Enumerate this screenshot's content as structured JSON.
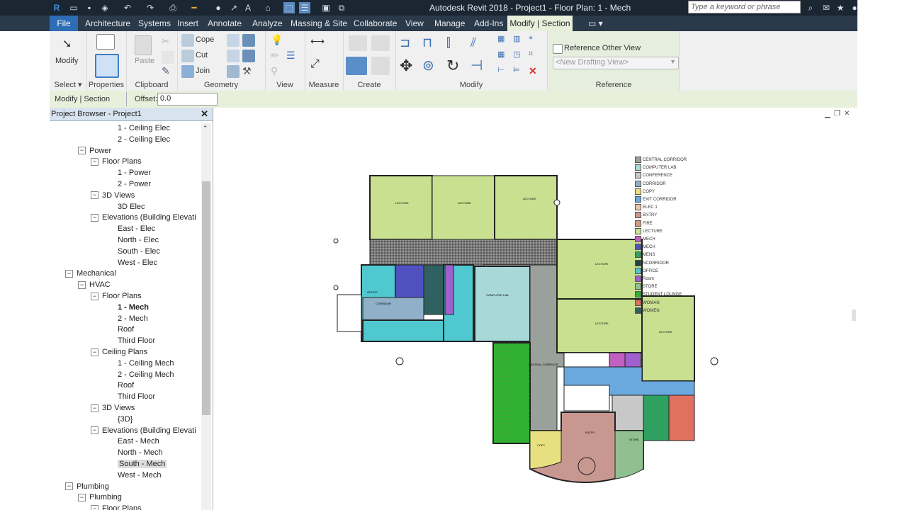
{
  "window": {
    "title": "Autodesk Revit 2018 -    Project1 - Floor Plan: 1 - Mech",
    "search_placeholder": "Type a keyword or phrase"
  },
  "tabs": [
    "File",
    "Architecture",
    "Systems",
    "Insert",
    "Annotate",
    "Analyze",
    "Massing & Site",
    "Collaborate",
    "View",
    "Manage",
    "Add-Ins",
    "Modify | Section"
  ],
  "ribbon": {
    "select_panel": {
      "button": "Modify",
      "label": "Select ▾"
    },
    "properties_panel": {
      "label": "Properties"
    },
    "clipboard_panel": {
      "paste": "Paste",
      "label": "Clipboard"
    },
    "geometry_panel": {
      "cope": "Cope",
      "cut": "Cut",
      "join": "Join",
      "label": "Geometry"
    },
    "view_panel": {
      "label": "View"
    },
    "measure_panel": {
      "label": "Measure"
    },
    "create_panel": {
      "label": "Create"
    },
    "modify_panel": {
      "label": "Modify"
    },
    "reference_panel": {
      "checkbox_label": "Reference Other View",
      "dropdown_value": "<New Drafting View>",
      "label": "Reference"
    }
  },
  "options_bar": {
    "context": "Modify | Section",
    "offset_label": "Offset:",
    "offset_value": "0.0"
  },
  "project_browser": {
    "title": "Project Browser - Project1",
    "nodes": [
      {
        "label": "1 - Ceiling Elec",
        "level": 4,
        "exp": ""
      },
      {
        "label": "2 - Ceiling Elec",
        "level": 4,
        "exp": ""
      },
      {
        "label": "Power",
        "level": 2,
        "exp": "−"
      },
      {
        "label": "Floor Plans",
        "level": 3,
        "exp": "−"
      },
      {
        "label": "1 - Power",
        "level": 4,
        "exp": ""
      },
      {
        "label": "2 - Power",
        "level": 4,
        "exp": ""
      },
      {
        "label": "3D Views",
        "level": 3,
        "exp": "−"
      },
      {
        "label": "3D Elec",
        "level": 4,
        "exp": ""
      },
      {
        "label": "Elevations (Building Elevati",
        "level": 3,
        "exp": "−"
      },
      {
        "label": "East - Elec",
        "level": 4,
        "exp": ""
      },
      {
        "label": "North - Elec",
        "level": 4,
        "exp": ""
      },
      {
        "label": "South - Elec",
        "level": 4,
        "exp": ""
      },
      {
        "label": "West - Elec",
        "level": 4,
        "exp": ""
      },
      {
        "label": "Mechanical",
        "level": 1,
        "exp": "−"
      },
      {
        "label": "HVAC",
        "level": 2,
        "exp": "−"
      },
      {
        "label": "Floor Plans",
        "level": 3,
        "exp": "−"
      },
      {
        "label": "1 - Mech",
        "level": 4,
        "exp": "",
        "bold": true
      },
      {
        "label": "2 - Mech",
        "level": 4,
        "exp": ""
      },
      {
        "label": "Roof",
        "level": 4,
        "exp": ""
      },
      {
        "label": "Third Floor",
        "level": 4,
        "exp": ""
      },
      {
        "label": "Ceiling Plans",
        "level": 3,
        "exp": "−"
      },
      {
        "label": "1 - Ceiling Mech",
        "level": 4,
        "exp": ""
      },
      {
        "label": "2 - Ceiling Mech",
        "level": 4,
        "exp": ""
      },
      {
        "label": "Roof",
        "level": 4,
        "exp": ""
      },
      {
        "label": "Third Floor",
        "level": 4,
        "exp": ""
      },
      {
        "label": "3D Views",
        "level": 3,
        "exp": "−"
      },
      {
        "label": "{3D}",
        "level": 4,
        "exp": ""
      },
      {
        "label": "Elevations (Building Elevati",
        "level": 3,
        "exp": "−"
      },
      {
        "label": "East - Mech",
        "level": 4,
        "exp": ""
      },
      {
        "label": "North - Mech",
        "level": 4,
        "exp": ""
      },
      {
        "label": "South - Mech",
        "level": 4,
        "exp": "",
        "selected": true
      },
      {
        "label": "West - Mech",
        "level": 4,
        "exp": ""
      },
      {
        "label": "Plumbing",
        "level": 1,
        "exp": "−"
      },
      {
        "label": "Plumbing",
        "level": 2,
        "exp": "−"
      },
      {
        "label": "Floor Plans",
        "level": 3,
        "exp": "−"
      }
    ]
  },
  "legend": [
    {
      "label": "CENTRAL CORRIDOR",
      "color": "#9aa09a"
    },
    {
      "label": "COMPUTER LAB",
      "color": "#a8d8d8"
    },
    {
      "label": "CONFERENCE",
      "color": "#c8c8c8"
    },
    {
      "label": "CORRIDOR",
      "color": "#8fb0c8"
    },
    {
      "label": "COPY",
      "color": "#e8e080"
    },
    {
      "label": "EXIT CORRIDOR",
      "color": "#6aa8e0"
    },
    {
      "label": "ELEC 1",
      "color": "#e8c8a8"
    },
    {
      "label": "ENTRY",
      "color": "#c89890"
    },
    {
      "label": "FIRE",
      "color": "#d09a80"
    },
    {
      "label": "LECTURE",
      "color": "#c8e090"
    },
    {
      "label": "MECH",
      "color": "#c060c0"
    },
    {
      "label": "MECH",
      "color": "#5050c0"
    },
    {
      "label": "MENS",
      "color": "#30a060"
    },
    {
      "label": "NCORRIDOR",
      "color": "#204040"
    },
    {
      "label": "OFFICE",
      "color": "#50c8d0"
    },
    {
      "label": "Room",
      "color": "#a060d0"
    },
    {
      "label": "STORE",
      "color": "#90c090"
    },
    {
      "label": "STUDENT LOUNGE",
      "color": "#30b030"
    },
    {
      "label": "WOMAN",
      "color": "#e07060"
    },
    {
      "label": "WOMEN",
      "color": "#306060"
    }
  ],
  "plan_labels": {
    "lecture": "LECTURE",
    "computer_lab": "COMPUTER LAB",
    "central_corridor": "CENTRAL CORRIDOR",
    "office": "OFFICE",
    "corridor": "CORRIDOR",
    "store": "STORE",
    "copy": "COPY",
    "student_lounge": "STUDENT LOUNGE",
    "entry": "ENTRY"
  }
}
